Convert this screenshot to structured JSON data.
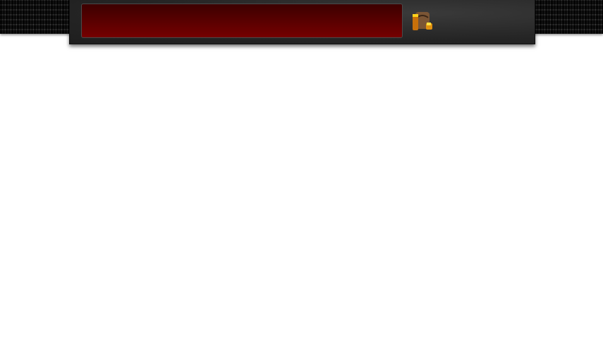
{
  "colors": {
    "bar_top": "#3c0000",
    "bar_bottom": "#750000",
    "panel": "#252525"
  },
  "icons": {
    "inventory": "bag-icon"
  }
}
